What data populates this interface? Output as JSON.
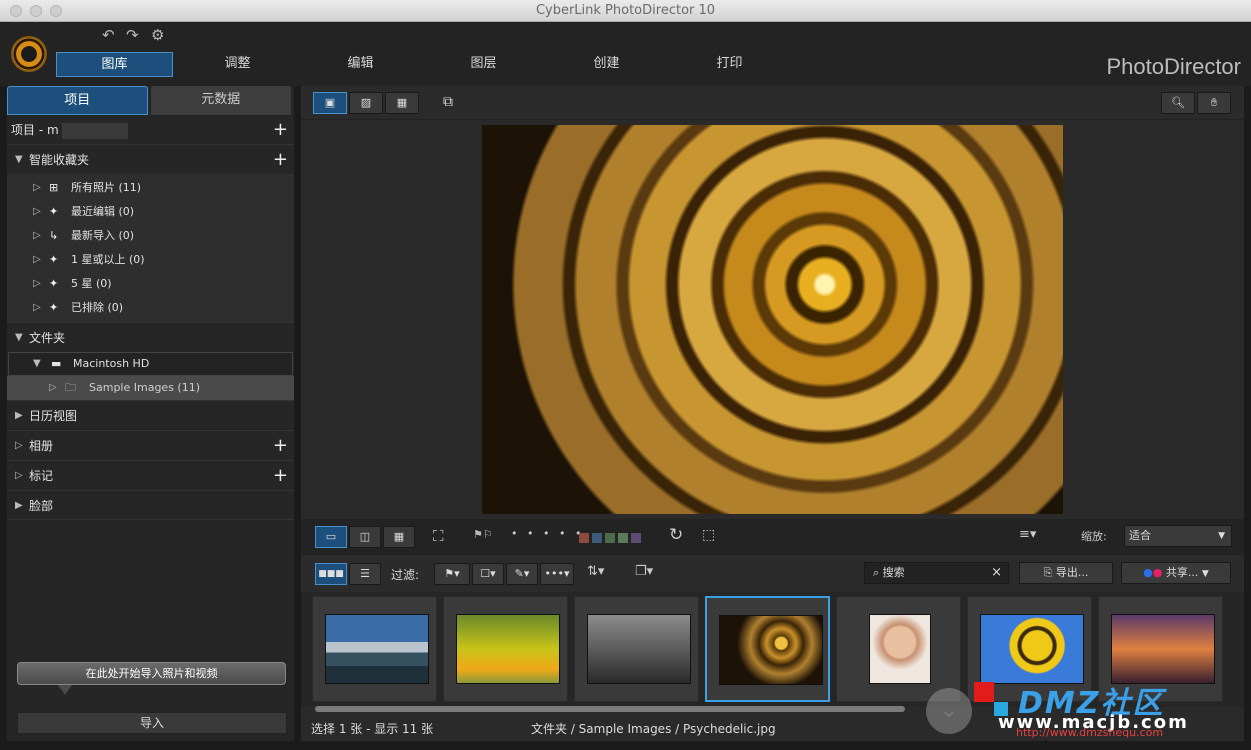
{
  "window": {
    "title": "CyberLink PhotoDirector 10"
  },
  "brand": "PhotoDirector",
  "main_tabs": [
    "图库",
    "调整",
    "编辑",
    "图层",
    "创建",
    "打印"
  ],
  "left_panel": {
    "tabs": [
      "项目",
      "元数据"
    ],
    "project_label": "项目 - m",
    "smart_collections": {
      "title": "智能收藏夹",
      "items": [
        "所有照片 (11)",
        "最近编辑 (0)",
        "最新导入 (0)",
        "1 星或以上 (0)",
        "5 星 (0)",
        "已排除 (0)"
      ]
    },
    "folders": {
      "title": "文件夹",
      "drive": "Macintosh HD",
      "folder": "Sample Images (11)"
    },
    "calendar": "日历视图",
    "albums": "相册",
    "tags": "标记",
    "faces": "脸部",
    "tooltip": "在此处开始导入照片和视频",
    "import_button": "导入"
  },
  "compare_toolbar": {
    "zoom_label": "缩放:",
    "zoom_value": "适合",
    "colors": [
      "#8b4a3c",
      "#3d5a7a",
      "#4c6b4c",
      "#5a7a5a",
      "#5c4c74"
    ]
  },
  "filter_toolbar": {
    "filter_label": "过滤:",
    "search_placeholder": "搜索",
    "export_label": "导出...",
    "share_label": "共享..."
  },
  "status_bar": {
    "selection": "选择 1 张 - 显示 11 张",
    "path": "文件夹 / Sample Images / Psychedelic.jpg"
  },
  "watermark": {
    "text": "DMZ社区",
    "url": "www.macjb.com",
    "sub_url": "http://www.dmzshequ.com"
  },
  "accent": "#3aa0e8"
}
